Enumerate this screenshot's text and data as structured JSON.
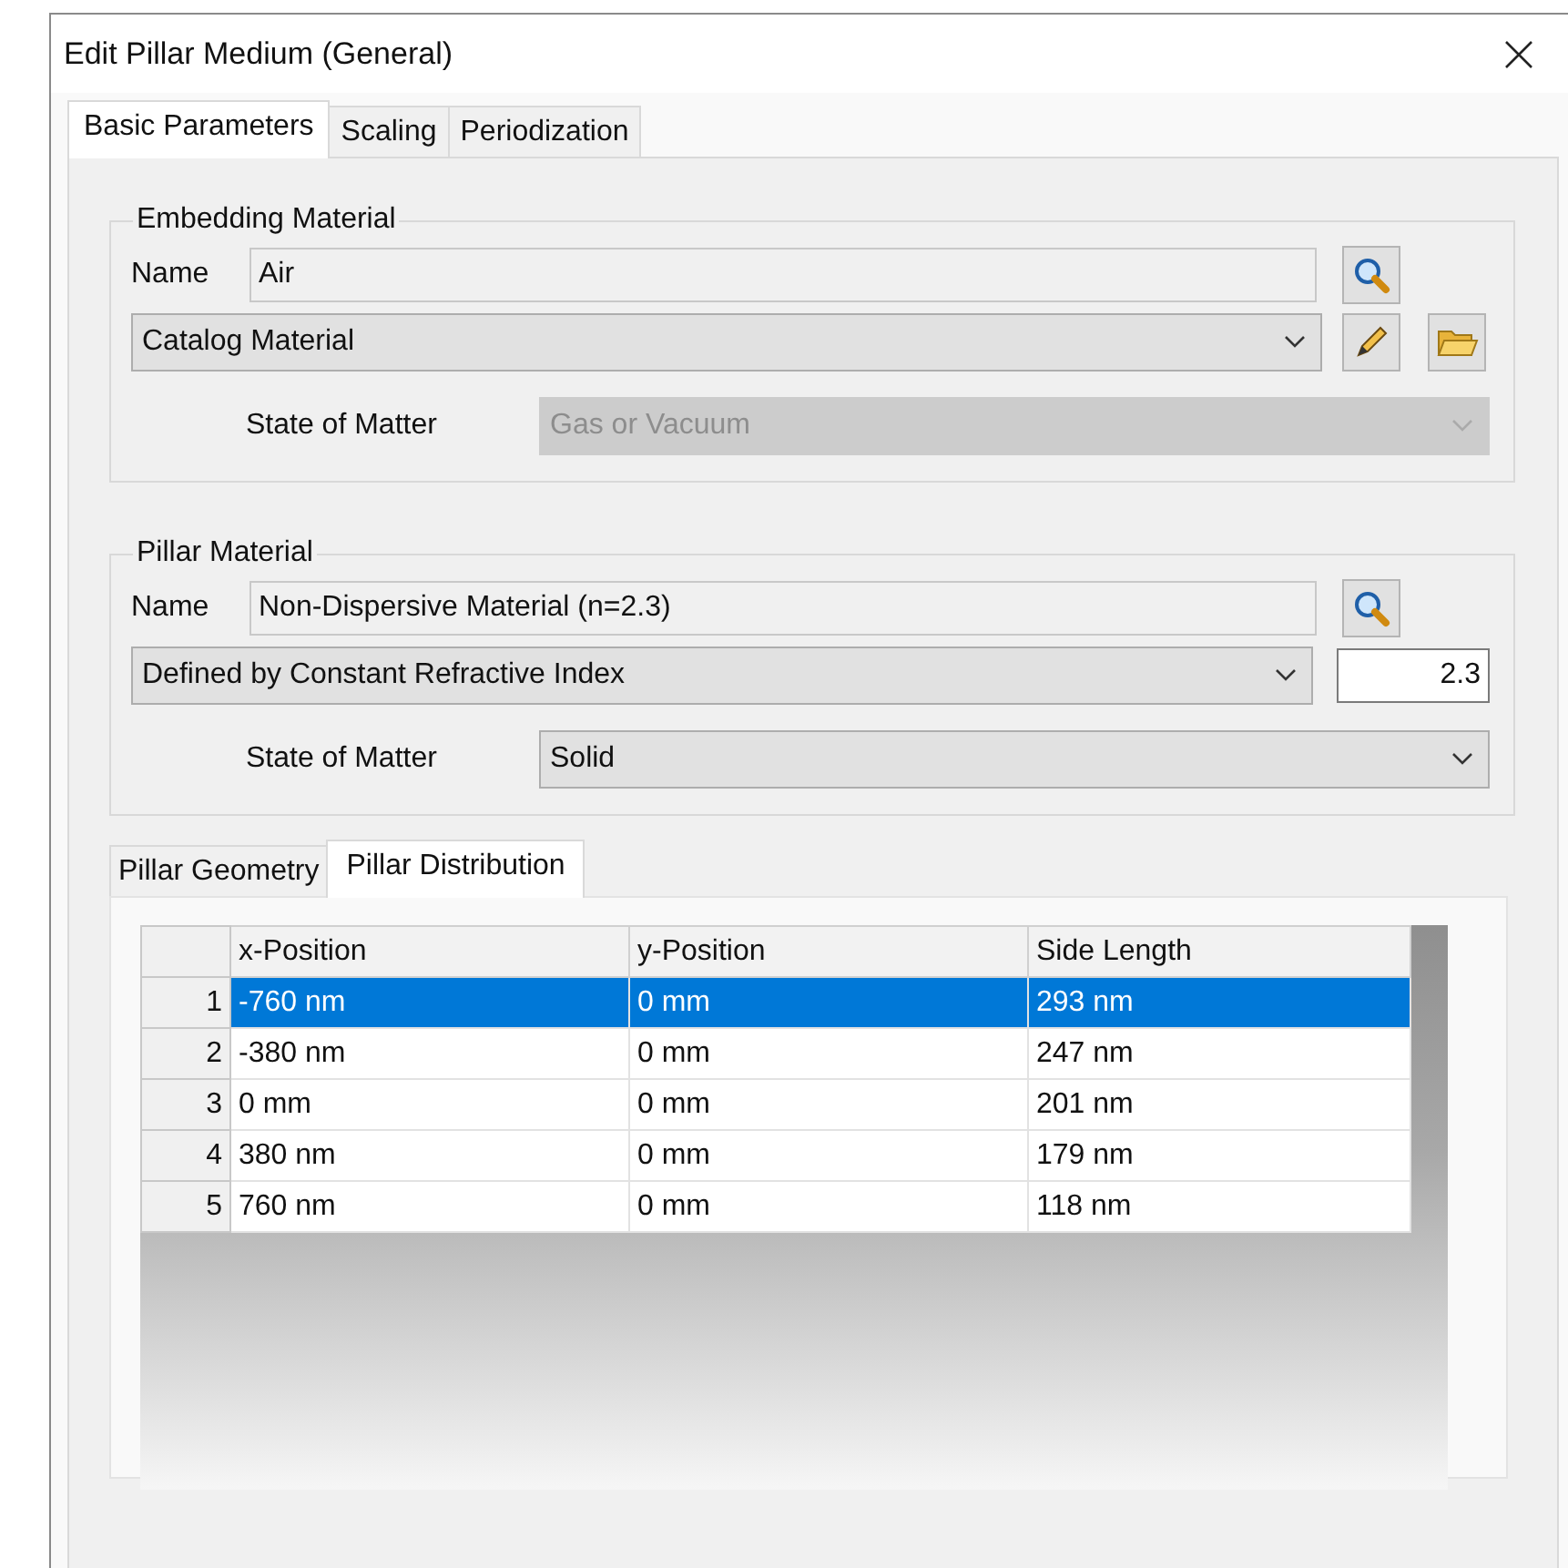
{
  "window": {
    "title": "Edit Pillar Medium (General)"
  },
  "tabs": [
    {
      "label": "Basic Parameters",
      "selected": true
    },
    {
      "label": "Scaling",
      "selected": false
    },
    {
      "label": "Periodization",
      "selected": false
    }
  ],
  "embedding_material": {
    "title": "Embedding Material",
    "name_label": "Name",
    "name_value": "Air",
    "type": "Catalog Material",
    "state_label": "State of Matter",
    "state_value": "Gas or Vacuum",
    "state_disabled": true
  },
  "pillar_material": {
    "title": "Pillar Material",
    "name_label": "Name",
    "name_value": "Non-Dispersive Material (n=2.3)",
    "type": "Defined by Constant Refractive Index",
    "refractive_index": "2.3",
    "state_label": "State of Matter",
    "state_value": "Solid",
    "state_disabled": false
  },
  "inner_tabs": [
    {
      "label": "Pillar Geometry",
      "selected": false
    },
    {
      "label": "Pillar Distribution",
      "selected": true
    }
  ],
  "table": {
    "columns": [
      "x-Position",
      "y-Position",
      "Side Length"
    ],
    "rows": [
      {
        "number": "1",
        "cells": [
          "-760 nm",
          "0 mm",
          "293 nm"
        ],
        "selected": true
      },
      {
        "number": "2",
        "cells": [
          "-380 nm",
          "0 mm",
          "247 nm"
        ],
        "selected": false
      },
      {
        "number": "3",
        "cells": [
          "0 mm",
          "0 mm",
          "201 nm"
        ],
        "selected": false
      },
      {
        "number": "4",
        "cells": [
          "380 nm",
          "0 mm",
          "179 nm"
        ],
        "selected": false
      },
      {
        "number": "5",
        "cells": [
          "760 nm",
          "0 mm",
          "118 nm"
        ],
        "selected": false
      }
    ]
  }
}
